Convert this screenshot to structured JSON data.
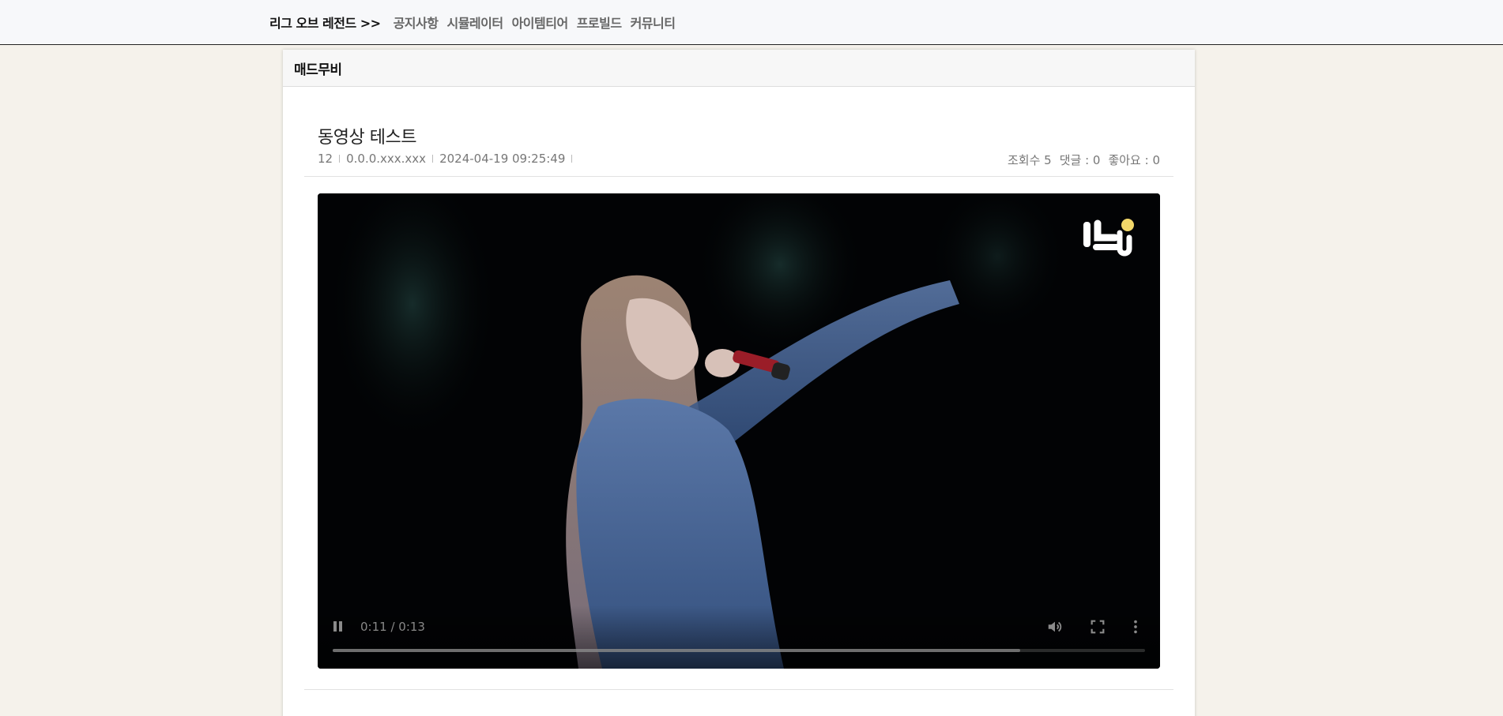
{
  "nav": {
    "brand": "리그 오브 레전드 >>",
    "links": [
      "공지사항",
      "시뮬레이터",
      "아이템티어",
      "프로빌드",
      "커뮤니티"
    ]
  },
  "board": {
    "title": "매드무비"
  },
  "post": {
    "title": "동영상 테스트",
    "number": "12",
    "author": "0.0.0.xxx.xxx",
    "datetime": "2024-04-19 09:25:49",
    "views": "조회수 5",
    "comments": "댓글 : 0",
    "likes": "좋아요 : 0"
  },
  "video": {
    "time_display": "0:11 / 0:13",
    "progress": 0.846,
    "playing": true,
    "watermark": "빠b"
  },
  "colors": {
    "page_bg": "#f5f2eb",
    "nav_bg": "#f7f8fa",
    "video_bg": "#000000"
  }
}
